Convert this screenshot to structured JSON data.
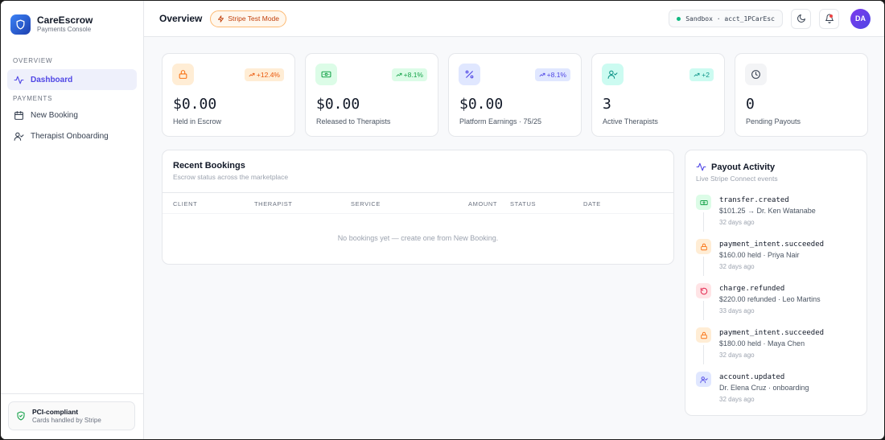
{
  "brand": {
    "name": "CareEscrow",
    "subtitle": "Payments Console"
  },
  "sidebar": {
    "sections": [
      {
        "title": "OVERVIEW",
        "items": [
          {
            "label": "Dashboard",
            "icon": "activity-icon",
            "active": true
          }
        ]
      },
      {
        "title": "PAYMENTS",
        "items": [
          {
            "label": "New Booking",
            "icon": "calendar-icon"
          },
          {
            "label": "Therapist Onboarding",
            "icon": "user-check-icon"
          }
        ]
      }
    ],
    "footer": {
      "title": "PCI-compliant",
      "subtitle": "Cards handled by Stripe",
      "icon": "shield-check-icon"
    }
  },
  "header": {
    "title": "Overview",
    "badge": "Stripe Test Mode",
    "environment": "Sandbox · acct_1PCarEsc",
    "avatar": "DA"
  },
  "stats": [
    {
      "value": "$0.00",
      "label": "Held in Escrow",
      "delta": "+12.4%",
      "icon": "lock-icon",
      "color": "#f97316"
    },
    {
      "value": "$0.00",
      "label": "Released to Therapists",
      "delta": "+8.1%",
      "icon": "banknote-icon",
      "color": "#16a34a"
    },
    {
      "value": "$0.00",
      "label": "Platform Earnings · 75/25",
      "delta": "+8.1%",
      "icon": "percent-icon",
      "color": "#4f46e5"
    },
    {
      "value": "3",
      "label": "Active Therapists",
      "delta": "+2",
      "icon": "user-check-icon",
      "color": "#0d9488"
    },
    {
      "value": "0",
      "label": "Pending Payouts",
      "delta": "",
      "icon": "clock-icon",
      "color": "#374151"
    }
  ],
  "bookings": {
    "title": "Recent Bookings",
    "subtitle": "Escrow status across the marketplace",
    "columns": [
      "CLIENT",
      "THERAPIST",
      "SERVICE",
      "AMOUNT",
      "STATUS",
      "DATE"
    ],
    "empty": "No bookings yet — create one from New Booking."
  },
  "payouts": {
    "title": "Payout Activity",
    "subtitle": "Live Stripe Connect events",
    "items": [
      {
        "event": "transfer.created",
        "detail": "$101.25 → Dr. Ken Watanabe",
        "time": "32 days ago",
        "icon": "banknote-icon",
        "color": "#16a34a"
      },
      {
        "event": "payment_intent.succeeded",
        "detail": "$160.00 held · Priya Nair",
        "time": "32 days ago",
        "icon": "lock-icon",
        "color": "#f97316"
      },
      {
        "event": "charge.refunded",
        "detail": "$220.00 refunded · Leo Martins",
        "time": "33 days ago",
        "icon": "refund-icon",
        "color": "#e11d48"
      },
      {
        "event": "payment_intent.succeeded",
        "detail": "$180.00 held · Maya Chen",
        "time": "32 days ago",
        "icon": "lock-icon",
        "color": "#f97316"
      },
      {
        "event": "account.updated",
        "detail": "Dr. Elena Cruz · onboarding",
        "time": "32 days ago",
        "icon": "user-check-icon",
        "color": "#4f46e5"
      }
    ]
  },
  "colors": {
    "accent": "#4f46e5",
    "warning": "#f97316",
    "success": "#16a34a",
    "danger": "#e11d48",
    "online": "#10b981"
  }
}
